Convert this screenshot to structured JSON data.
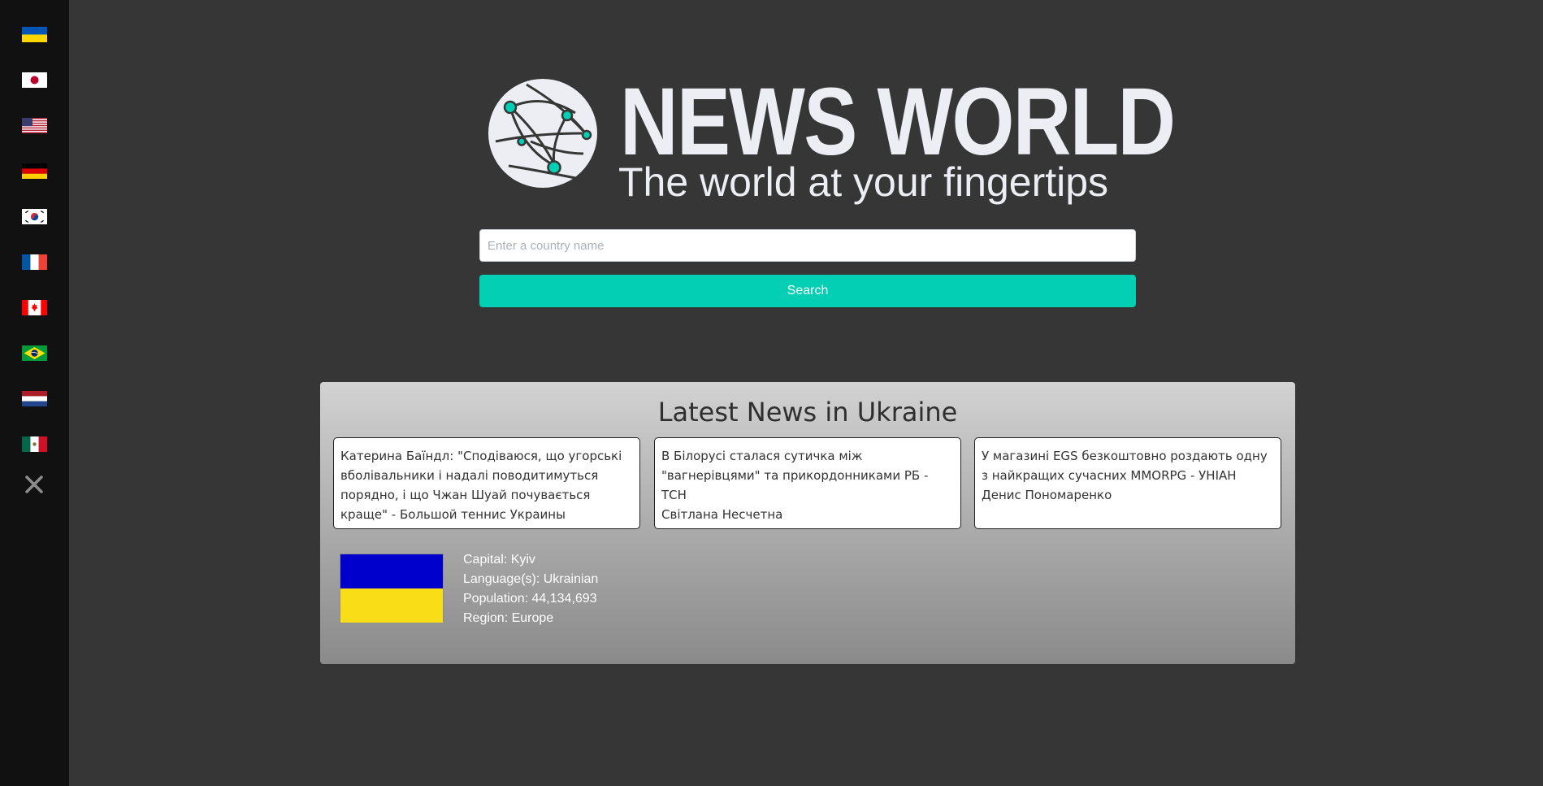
{
  "sidebar": {
    "flags": [
      {
        "name": "ukraine-flag",
        "country": "Ukraine"
      },
      {
        "name": "japan-flag",
        "country": "Japan"
      },
      {
        "name": "usa-flag",
        "country": "United States"
      },
      {
        "name": "germany-flag",
        "country": "Germany"
      },
      {
        "name": "south-korea-flag",
        "country": "South Korea"
      },
      {
        "name": "france-flag",
        "country": "France"
      },
      {
        "name": "canada-flag",
        "country": "Canada"
      },
      {
        "name": "brazil-flag",
        "country": "Brazil"
      },
      {
        "name": "netherlands-flag",
        "country": "Netherlands"
      },
      {
        "name": "mexico-flag",
        "country": "Mexico"
      }
    ],
    "close_icon": "close-icon"
  },
  "header": {
    "brand": "NEWS WORLD",
    "tagline": "The world at your fingertips",
    "logo_icon": "globe-network-icon"
  },
  "search": {
    "placeholder": "Enter a country name",
    "value": "",
    "button_label": "Search"
  },
  "news": {
    "title": "Latest News in Ukraine",
    "articles": [
      {
        "headline": "Катерина Баїндл: \"Сподіваюся, що угорські вболівальники і надалі поводитимуться порядно, і що Чжан Шуай почувається краще\" - Большой теннис Украины",
        "author": ""
      },
      {
        "headline": "В Білорусі сталася сутичка між \"вагнерівцями\" та прикордонниками РБ - ТСН",
        "author": "Світлана Несчетна"
      },
      {
        "headline": "У магазині EGS безкоштовно роздають одну з найкращих сучасних MMORPG - УНІАН",
        "author": "Денис Пономаренко"
      }
    ]
  },
  "country": {
    "capital": "Capital: Kyiv",
    "languages": "Language(s): Ukrainian",
    "population": "Population: 44,134,693",
    "region": "Region: Europe"
  },
  "colors": {
    "background": "#363636",
    "sidebar": "#111111",
    "accent": "#03cfb4",
    "brand_text": "#eceef3"
  }
}
